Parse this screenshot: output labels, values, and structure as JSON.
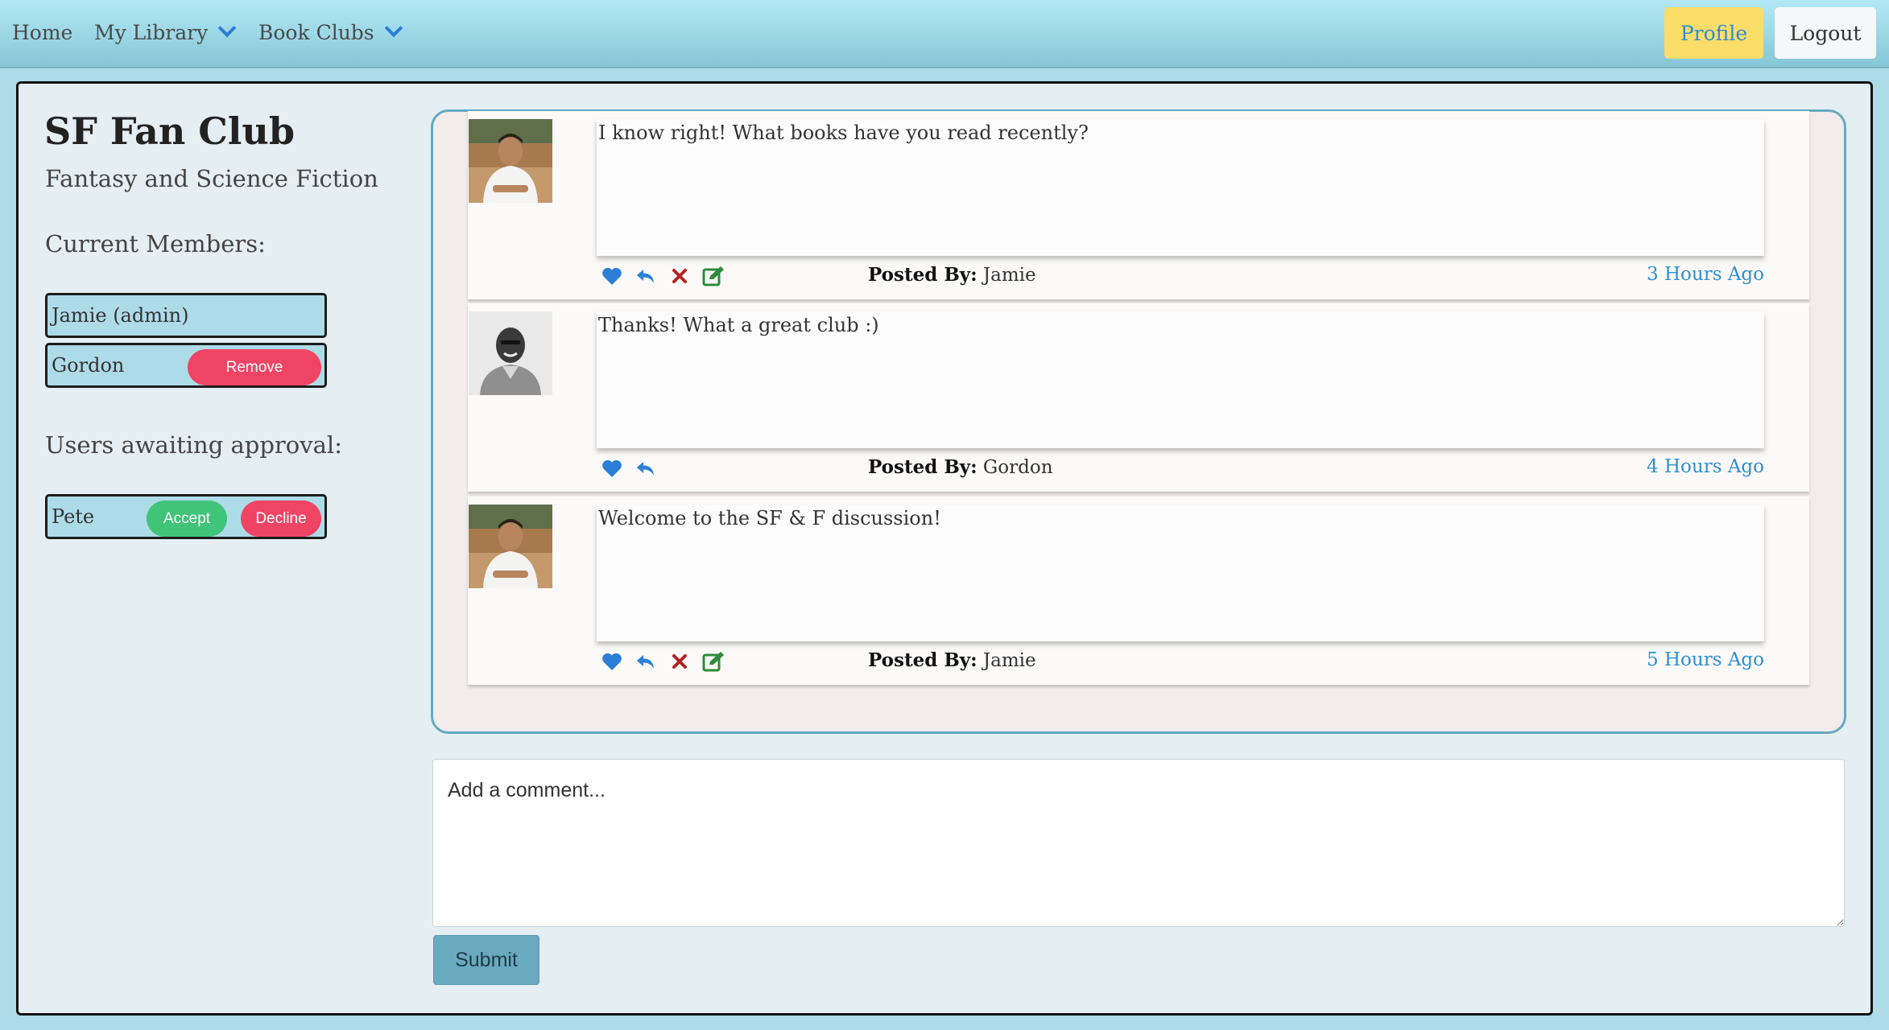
{
  "nav": {
    "home": "Home",
    "my_library": "My Library",
    "book_clubs": "Book Clubs",
    "profile": "Profile",
    "logout": "Logout"
  },
  "club": {
    "title": "SF Fan Club",
    "subtitle": "Fantasy and Science Fiction",
    "members_heading": "Current Members:",
    "members": [
      {
        "name": "Jamie (admin)"
      },
      {
        "name": "Gordon",
        "action": "Remove"
      }
    ],
    "awaiting_heading": "Users awaiting approval:",
    "awaiting": [
      {
        "name": "Pete",
        "accept": "Accept",
        "decline": "Decline"
      }
    ]
  },
  "comments": [
    {
      "text": "I know right! What books have you read recently?",
      "posted_by_label": "Posted By:",
      "author": "Jamie",
      "time": "3 Hours Ago",
      "icons": [
        "heart-icon",
        "reply-icon",
        "delete-icon",
        "edit-icon"
      ]
    },
    {
      "text": "Thanks! What a great club :)",
      "posted_by_label": "Posted By:",
      "author": "Gordon",
      "time": "4 Hours Ago",
      "icons": [
        "heart-icon",
        "reply-icon"
      ]
    },
    {
      "text": "Welcome to the SF & F discussion!",
      "posted_by_label": "Posted By:",
      "author": "Jamie",
      "time": "5 Hours Ago",
      "icons": [
        "heart-icon",
        "reply-icon",
        "delete-icon",
        "edit-icon"
      ]
    }
  ],
  "add_comment": {
    "placeholder": "Add a comment...",
    "submit": "Submit"
  },
  "colors": {
    "accent_blue": "#2c7fd6",
    "profile_yellow": "#fbdd6a",
    "remove_red": "#f04465",
    "accept_green": "#3fc479",
    "delete_red": "#b22222",
    "edit_green": "#2e8b3a"
  }
}
